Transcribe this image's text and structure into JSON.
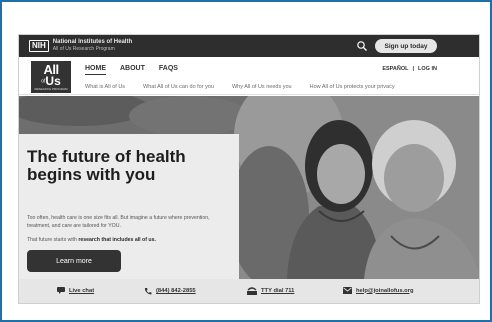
{
  "topbar": {
    "nih_mark": "NIH",
    "org_name": "National Institutes of Health",
    "program": "All of Us Research Program",
    "search_icon": "search-icon",
    "signup_label": "Sign up today"
  },
  "logo": {
    "all": "All",
    "of": "of",
    "us": "Us",
    "sub": "RESEARCH PROGRAM"
  },
  "nav": {
    "items": [
      "HOME",
      "ABOUT",
      "FAQS"
    ],
    "espanol": "ESPAÑOL",
    "separator": "|",
    "login": "LOG IN",
    "sub_items": [
      "What is All of Us",
      "What All of Us can do for you",
      "Why All of Us needs you",
      "How All of Us protects your privacy"
    ]
  },
  "hero": {
    "headline": "The future of health begins with you",
    "body": "Too often, health care is one size fits all. But imagine a future where prevention, treatment, and care are tailored for YOU.",
    "body2_prefix": "That future starts with",
    "body2_bold": "research that includes all of us.",
    "cta_label": "Learn more"
  },
  "contact": {
    "chat": {
      "label": "Live chat",
      "icon": "chat-icon"
    },
    "phone": {
      "label": "(844) 842-2855",
      "icon": "phone-icon"
    },
    "tty": {
      "label": "TTY dial 711",
      "icon": "tty-icon"
    },
    "email": {
      "label": "help@joinallofus.org",
      "icon": "mail-icon"
    }
  },
  "colors": {
    "frame_border": "#1f6fa8",
    "topbar_bg": "#2e2e2e",
    "panel_bg": "#ececec",
    "button_bg": "#333333",
    "contact_bg": "#e6e6e6"
  }
}
